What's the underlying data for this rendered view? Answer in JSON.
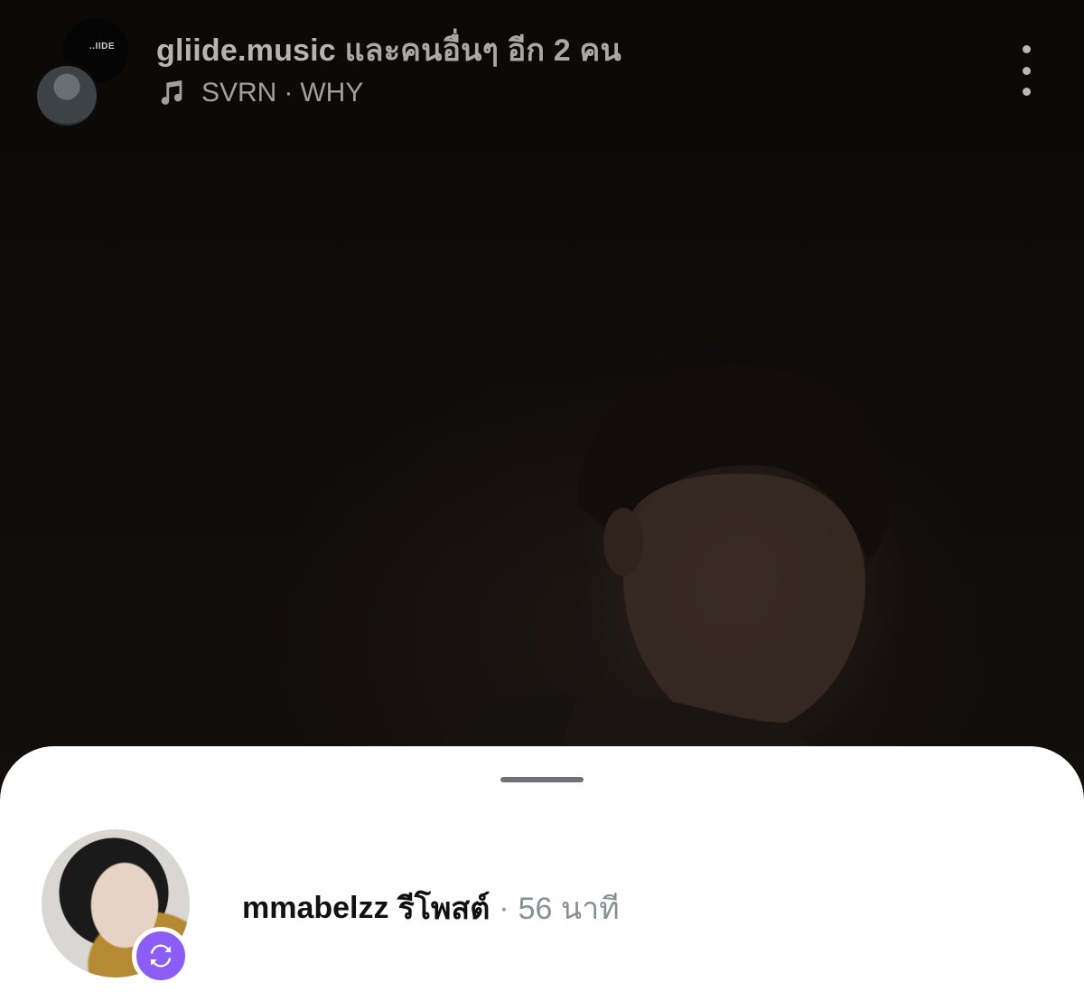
{
  "header": {
    "username": "gliide.music",
    "others_text": "และคนอื่นๆ อีก 2 คน",
    "brand_avatar_text": "..IIDE",
    "music": {
      "artist": "SVRN",
      "separator": "·",
      "song": "WHY"
    }
  },
  "icons": {
    "music": "music-note-icon",
    "more": "more-vertical-icon",
    "repost": "repost-icon"
  },
  "repost": {
    "username": "mmabelzz",
    "action": "รีโพสต์",
    "separator": "·",
    "time": "56 นาที"
  },
  "colors": {
    "background": "#0c0908",
    "sheet": "#ffffff",
    "repost_badge": "#8b5cf6",
    "muted_text": "#8a8d91"
  }
}
